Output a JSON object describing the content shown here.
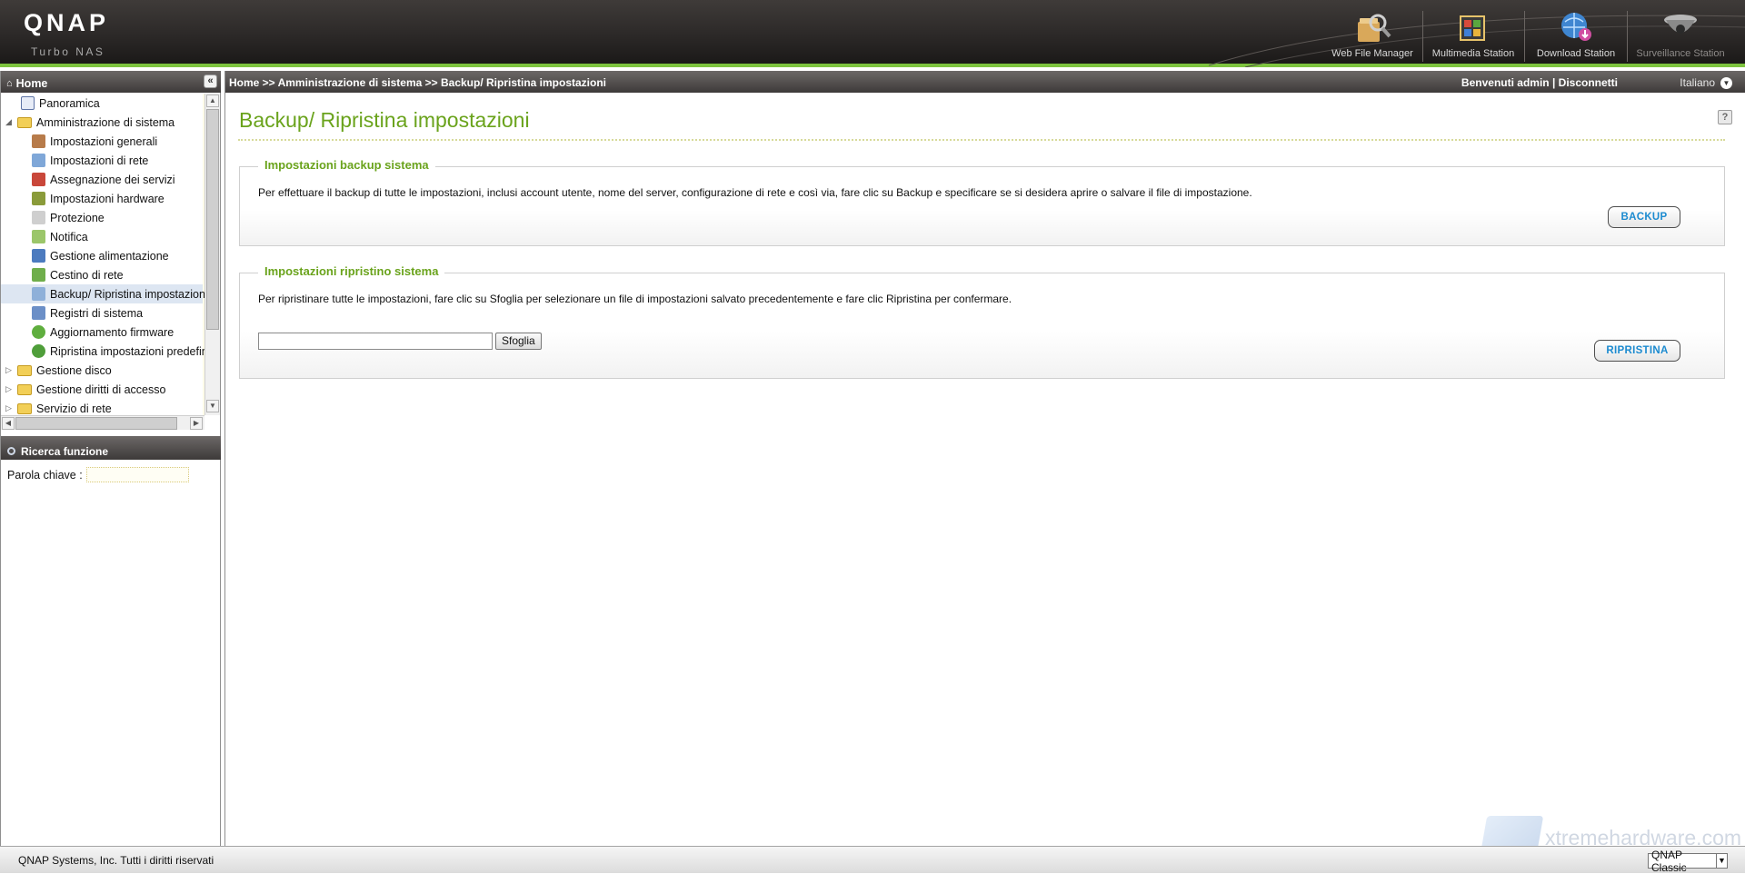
{
  "header": {
    "logo": "QNAP",
    "logo_sub": "Turbo NAS",
    "apps": [
      {
        "label": "Web File Manager",
        "icon": "web-file-manager-icon"
      },
      {
        "label": "Multimedia Station",
        "icon": "multimedia-station-icon"
      },
      {
        "label": "Download Station",
        "icon": "download-station-icon"
      },
      {
        "label": "Surveillance Station",
        "icon": "surveillance-station-icon"
      }
    ]
  },
  "sidebar": {
    "home_label": "Home",
    "tree": [
      {
        "label": "Panoramica",
        "icon": "overview-icon",
        "level": 0
      },
      {
        "label": "Amministrazione di sistema",
        "icon": "folder-open-icon",
        "level": 0,
        "expanded": true
      },
      {
        "label": "Impostazioni generali",
        "icon": "general-settings-icon",
        "level": 1
      },
      {
        "label": "Impostazioni di rete",
        "icon": "network-icon",
        "level": 1
      },
      {
        "label": "Assegnazione dei servizi",
        "icon": "services-icon",
        "level": 1
      },
      {
        "label": "Impostazioni hardware",
        "icon": "hardware-icon",
        "level": 1
      },
      {
        "label": "Protezione",
        "icon": "security-icon",
        "level": 1
      },
      {
        "label": "Notifica",
        "icon": "notification-icon",
        "level": 1
      },
      {
        "label": "Gestione alimentazione",
        "icon": "power-icon",
        "level": 1
      },
      {
        "label": "Cestino di rete",
        "icon": "recycle-bin-icon",
        "level": 1
      },
      {
        "label": "Backup/ Ripristina impostazioni",
        "icon": "backup-icon",
        "level": 1,
        "selected": true
      },
      {
        "label": "Registri di sistema",
        "icon": "logs-icon",
        "level": 1
      },
      {
        "label": "Aggiornamento firmware",
        "icon": "firmware-icon",
        "level": 1
      },
      {
        "label": "Ripristina impostazioni predefin",
        "icon": "reset-icon",
        "level": 1
      },
      {
        "label": "Gestione disco",
        "icon": "folder-icon",
        "level": 0
      },
      {
        "label": "Gestione diritti di accesso",
        "icon": "folder-icon",
        "level": 0
      },
      {
        "label": "Servizio di rete",
        "icon": "folder-icon",
        "level": 0
      }
    ],
    "search_title": "Ricerca funzione",
    "search_label": "Parola chiave :"
  },
  "main": {
    "breadcrumb": "Home >> Amministrazione di sistema >> Backup/ Ripristina impostazioni",
    "welcome": "Benvenuti admin",
    "logout": "Disconnetti",
    "language": "Italiano",
    "title": "Backup/ Ripristina impostazioni",
    "backup_section": {
      "legend": "Impostazioni backup sistema",
      "text": "Per effettuare il backup di tutte le impostazioni, inclusi account utente, nome del server, configurazione di rete e così via, fare clic su Backup e specificare se si desidera aprire o salvare il file di impostazione.",
      "button": "BACKUP"
    },
    "restore_section": {
      "legend": "Impostazioni ripristino sistema",
      "text": "Per ripristinare tutte le impostazioni, fare clic su Sfoglia per selezionare un file di impostazioni salvato precedentemente e fare clic Ripristina per confermare.",
      "file_value": "",
      "browse_button": "Sfoglia",
      "button": "RIPRISTINA"
    },
    "watermark": "xtremehardware.com"
  },
  "footer": {
    "copyright": "QNAP Systems, Inc. Tutti i diritti riservati",
    "theme": "QNAP Classic"
  },
  "colors": {
    "accent_green": "#6aa31c",
    "header_line": "#7ec43f",
    "button_text": "#1c8bd0"
  }
}
